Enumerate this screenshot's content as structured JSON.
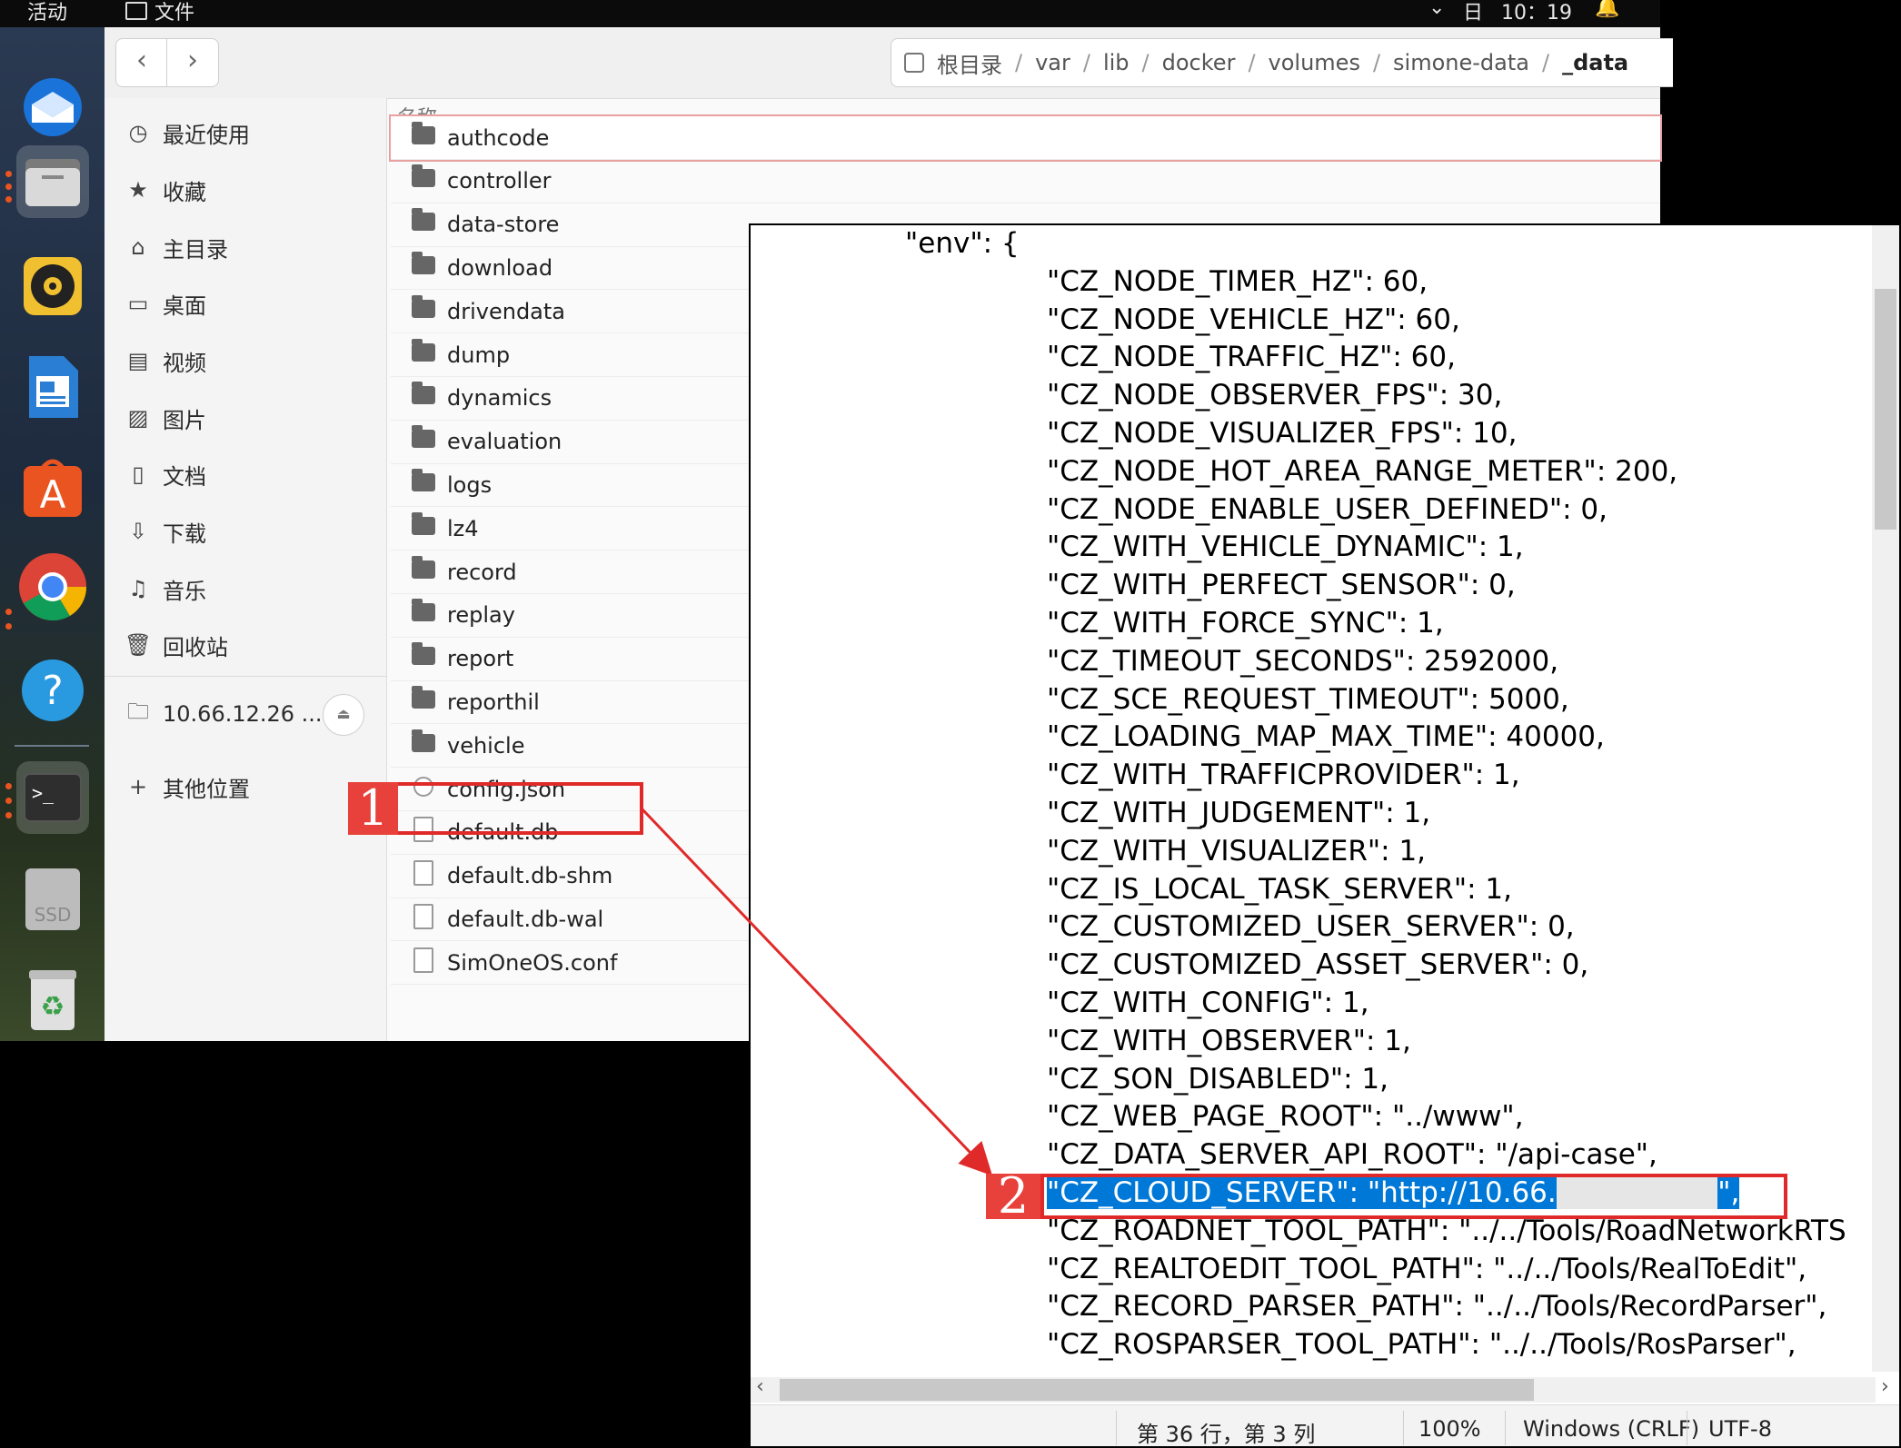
{
  "topbar": {
    "activities": "活动",
    "app_name": "文件",
    "clock": "10：19"
  },
  "dock": {
    "apps": [
      "thunderbird-icon",
      "files-icon",
      "rhythmbox-icon",
      "writer-icon",
      "app-center-icon",
      "chrome-icon",
      "help-icon",
      "terminal-icon",
      "ssd-icon",
      "trash-icon"
    ],
    "ssd_label": "SSD"
  },
  "file_manager": {
    "path": [
      "根目录",
      "var",
      "lib",
      "docker",
      "volumes",
      "simone-data",
      "_data"
    ],
    "column_name": "名称",
    "sidebar": [
      {
        "icon": "clock-icon",
        "label": "最近使用"
      },
      {
        "icon": "star-icon",
        "label": "收藏"
      },
      {
        "icon": "home-icon",
        "label": "主目录"
      },
      {
        "icon": "desktop-icon",
        "label": "桌面"
      },
      {
        "icon": "video-icon",
        "label": "视频"
      },
      {
        "icon": "picture-icon",
        "label": "图片"
      },
      {
        "icon": "document-icon",
        "label": "文档"
      },
      {
        "icon": "download-icon",
        "label": "下载"
      },
      {
        "icon": "music-icon",
        "label": "音乐"
      },
      {
        "icon": "trash-icon",
        "label": "回收站"
      }
    ],
    "network_location": "10.66.12.26 ...",
    "other_locations": "其他位置",
    "files": [
      {
        "name": "authcode",
        "type": "folder"
      },
      {
        "name": "controller",
        "type": "folder"
      },
      {
        "name": "data-store",
        "type": "folder"
      },
      {
        "name": "download",
        "type": "folder"
      },
      {
        "name": "drivendata",
        "type": "folder"
      },
      {
        "name": "dump",
        "type": "folder"
      },
      {
        "name": "dynamics",
        "type": "folder"
      },
      {
        "name": "evaluation",
        "type": "folder"
      },
      {
        "name": "logs",
        "type": "folder"
      },
      {
        "name": "lz4",
        "type": "folder"
      },
      {
        "name": "record",
        "type": "folder"
      },
      {
        "name": "replay",
        "type": "folder"
      },
      {
        "name": "report",
        "type": "folder"
      },
      {
        "name": "reporthil",
        "type": "folder"
      },
      {
        "name": "vehicle",
        "type": "folder"
      },
      {
        "name": "config.json",
        "type": "json"
      },
      {
        "name": "default.db",
        "type": "file"
      },
      {
        "name": "default.db-shm",
        "type": "file"
      },
      {
        "name": "default.db-wal",
        "type": "file"
      },
      {
        "name": "SimOneOS.conf",
        "type": "file"
      }
    ]
  },
  "editor": {
    "lines": [
      "\"env\": {",
      "\"CZ_NODE_TIMER_HZ\": 60,",
      "\"CZ_NODE_VEHICLE_HZ\": 60,",
      "\"CZ_NODE_TRAFFIC_HZ\": 60,",
      "\"CZ_NODE_OBSERVER_FPS\": 30,",
      "\"CZ_NODE_VISUALIZER_FPS\": 10,",
      "\"CZ_NODE_HOT_AREA_RANGE_METER\": 200,",
      "\"CZ_NODE_ENABLE_USER_DEFINED\": 0,",
      "\"CZ_WITH_VEHICLE_DYNAMIC\": 1,",
      "\"CZ_WITH_PERFECT_SENSOR\": 0,",
      "\"CZ_WITH_FORCE_SYNC\": 1,",
      "\"CZ_TIMEOUT_SECONDS\": 2592000,",
      "\"CZ_SCE_REQUEST_TIMEOUT\": 5000,",
      "\"CZ_LOADING_MAP_MAX_TIME\": 40000,",
      "\"CZ_WITH_TRAFFICPROVIDER\": 1,",
      "\"CZ_WITH_JUDGEMENT\": 1,",
      "\"CZ_WITH_VISUALIZER\": 1,",
      "\"CZ_IS_LOCAL_TASK_SERVER\": 1,",
      "\"CZ_CUSTOMIZED_USER_SERVER\": 0,",
      "\"CZ_CUSTOMIZED_ASSET_SERVER\": 0,",
      "\"CZ_WITH_CONFIG\": 1,",
      "\"CZ_WITH_OBSERVER\": 1,",
      "\"CZ_SON_DISABLED\": 1,",
      "\"CZ_WEB_PAGE_ROOT\": \"../www\",",
      "\"CZ_DATA_SERVER_API_ROOT\": \"/api-case\",",
      "\"CZ_CLOUD_SERVER\": \"http://10.66.",
      "\"CZ_ROADNET_TOOL_PATH\": \"../../Tools/RoadNetworkRTS",
      "\"CZ_REALTOEDIT_TOOL_PATH\": \"../../Tools/RealToEdit\",",
      "\"CZ_RECORD_PARSER_PATH\": \"../../Tools/RecordParser\",",
      "\"CZ_ROSPARSER_TOOL_PATH\": \"../../Tools/RosParser\","
    ],
    "highlight_tail": "\",",
    "status": {
      "position": "第 36 行，第 3 列",
      "zoom": "100%",
      "eol": "Windows (CRLF)",
      "encoding": "UTF-8"
    }
  },
  "annotations": {
    "step1": "1",
    "step2": "2"
  },
  "colors": {
    "accent_red": "#e02a2a",
    "selection_blue": "#0078d7"
  }
}
